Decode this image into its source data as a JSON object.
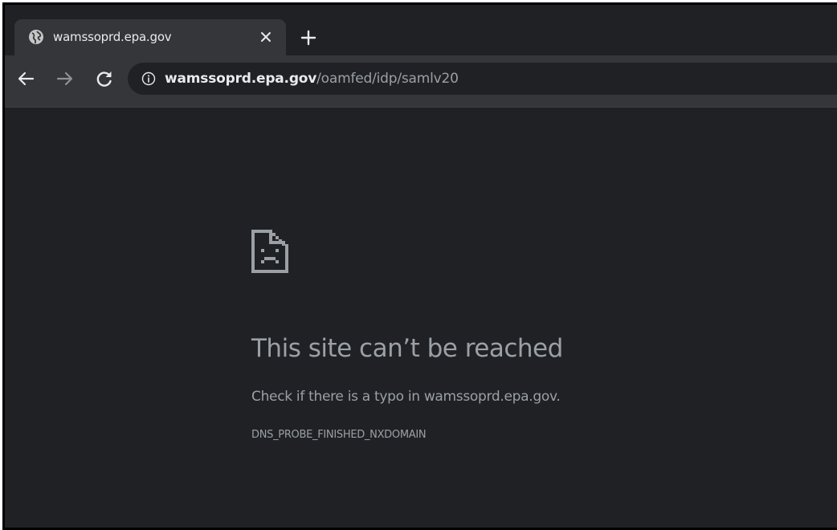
{
  "tab": {
    "title": "wamssoprd.epa.gov",
    "favicon": "globe-icon",
    "close_icon": "close-icon"
  },
  "new_tab": {
    "icon": "plus-icon"
  },
  "toolbar": {
    "back_icon": "arrow-left-icon",
    "forward_icon": "arrow-right-icon",
    "reload_icon": "reload-icon",
    "info_icon": "info-icon"
  },
  "address_bar": {
    "host": "wamssoprd.epa.gov",
    "path": "/oamfed/idp/samlv20"
  },
  "error_page": {
    "icon": "sad-document-icon",
    "heading": "This site can’t be reached",
    "description": "Check if there is a typo in wamssoprd.epa.gov.",
    "error_code": "DNS_PROBE_FINISHED_NXDOMAIN"
  },
  "colors": {
    "background": "#202124",
    "toolbar": "#35363a",
    "text_primary": "#e8eaed",
    "text_secondary": "#9aa0a6"
  }
}
